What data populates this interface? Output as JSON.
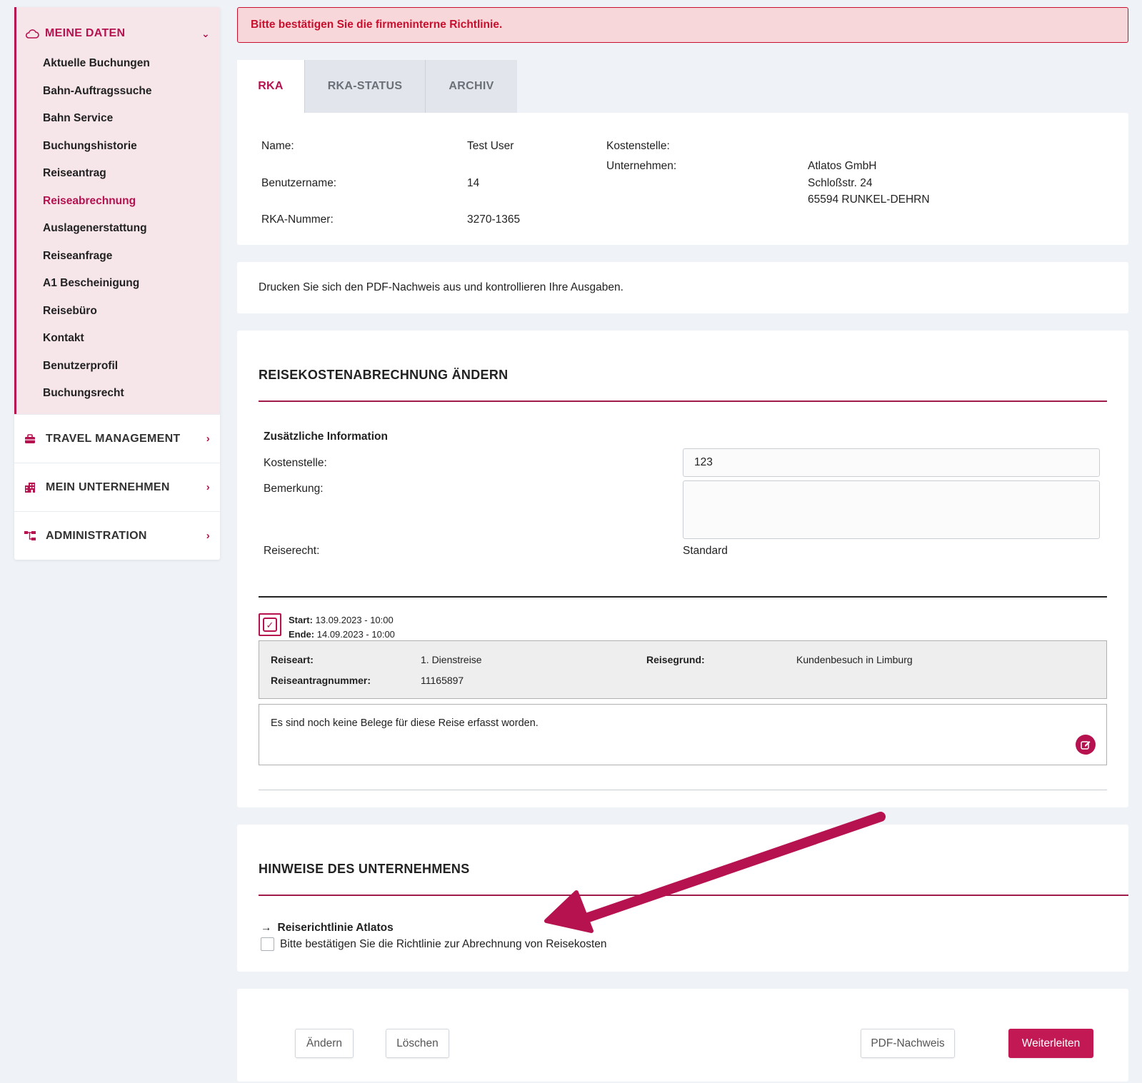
{
  "sidebar": {
    "active_section": {
      "label": "MEINE DATEN",
      "icon": "cloud-icon",
      "items": [
        {
          "label": "Aktuelle Buchungen"
        },
        {
          "label": "Bahn-Auftragssuche"
        },
        {
          "label": "Bahn Service"
        },
        {
          "label": "Buchungshistorie"
        },
        {
          "label": "Reiseantrag"
        },
        {
          "label": "Reiseabrechnung",
          "current": true
        },
        {
          "label": "Auslagenerstattung"
        },
        {
          "label": "Reiseanfrage"
        },
        {
          "label": "A1 Bescheinigung"
        },
        {
          "label": "Reisebüro"
        },
        {
          "label": "Kontakt"
        },
        {
          "label": "Benutzerprofil"
        },
        {
          "label": "Buchungsrecht"
        }
      ]
    },
    "groups": [
      {
        "label": "TRAVEL MANAGEMENT",
        "icon": "briefcase-icon"
      },
      {
        "label": "MEIN UNTERNEHMEN",
        "icon": "building-icon"
      },
      {
        "label": "ADMINISTRATION",
        "icon": "sitemap-icon"
      }
    ]
  },
  "alert": {
    "text": "Bitte bestätigen Sie die firmeninterne Richtlinie."
  },
  "tabs": [
    {
      "label": "RKA",
      "active": true
    },
    {
      "label": "RKA-STATUS"
    },
    {
      "label": "ARCHIV"
    }
  ],
  "info": {
    "name_label": "Name:",
    "name_value": "Test User",
    "username_label": "Benutzername:",
    "username_value": "14",
    "rka_label": "RKA-Nummer:",
    "rka_value": "3270-1365",
    "kostenstelle_label": "Kostenstelle:",
    "company_label": "Unternehmen:",
    "company_line1": "Atlatos GmbH",
    "company_line2": "Schloßstr. 24",
    "company_line3": "65594 RUNKEL-DEHRN"
  },
  "note": {
    "text": "Drucken Sie sich den PDF-Nachweis aus und kontrollieren Ihre Ausgaben."
  },
  "edit": {
    "title": "REISEKOSTENABRECHNUNG ÄNDERN",
    "additional_heading": "Zusätzliche Information",
    "kostenstelle_label": "Kostenstelle:",
    "kostenstelle_value": "123",
    "bemerkung_label": "Bemerkung:",
    "bemerkung_value": "",
    "reiserecht_label": "Reiserecht:",
    "reiserecht_value": "Standard",
    "trip": {
      "start_label": "Start:",
      "start_value": "13.09.2023 - 10:00",
      "end_label": "Ende:",
      "end_value": "14.09.2023 - 10:00",
      "reiseart_label": "Reiseart:",
      "reiseart_value": "1. Dienstreise",
      "reisegrund_label": "Reisegrund:",
      "reisegrund_value": "Kundenbesuch in Limburg",
      "antrag_label": "Reiseantragnummer:",
      "antrag_value": "11165897",
      "belege_text": "Es sind noch keine Belege für diese Reise erfasst worden."
    }
  },
  "hints": {
    "title": "HINWEISE DES UNTERNEHMENS",
    "link_arrow": "→",
    "link_label": "Reiserichtlinie Atlatos",
    "checkbox_label": "Bitte bestätigen Sie die Richtlinie zur Abrechnung von Reisekosten",
    "checked": false
  },
  "buttons": {
    "aendern": "Ändern",
    "loeschen": "Löschen",
    "pdf": "PDF-Nachweis",
    "weiterleiten": "Weiterleiten"
  },
  "colors": {
    "brand": "#b5124f",
    "alert_bg": "#f8d7da",
    "alert_text": "#c8102e",
    "page_bg": "#eff2f7"
  }
}
